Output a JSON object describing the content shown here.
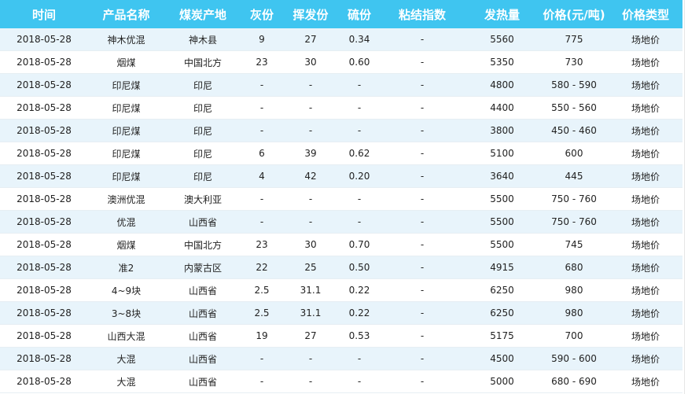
{
  "table": {
    "headers": [
      "时间",
      "产品名称",
      "煤炭产地",
      "灰份",
      "挥发份",
      "硫份",
      "粘结指数",
      "发热量",
      "价格(元/吨)",
      "价格类型"
    ],
    "rows": [
      [
        "2018-05-28",
        "神木优混",
        "神木县",
        "9",
        "27",
        "0.34",
        "-",
        "5560",
        "775",
        "场地价"
      ],
      [
        "2018-05-28",
        "烟煤",
        "中国北方",
        "23",
        "30",
        "0.60",
        "-",
        "5350",
        "730",
        "场地价"
      ],
      [
        "2018-05-28",
        "印尼煤",
        "印尼",
        "-",
        "-",
        "-",
        "-",
        "4800",
        "580 - 590",
        "场地价"
      ],
      [
        "2018-05-28",
        "印尼煤",
        "印尼",
        "-",
        "-",
        "-",
        "-",
        "4400",
        "550 - 560",
        "场地价"
      ],
      [
        "2018-05-28",
        "印尼煤",
        "印尼",
        "-",
        "-",
        "-",
        "-",
        "3800",
        "450 - 460",
        "场地价"
      ],
      [
        "2018-05-28",
        "印尼煤",
        "印尼",
        "6",
        "39",
        "0.62",
        "-",
        "5100",
        "600",
        "场地价"
      ],
      [
        "2018-05-28",
        "印尼煤",
        "印尼",
        "4",
        "42",
        "0.20",
        "-",
        "3640",
        "445",
        "场地价"
      ],
      [
        "2018-05-28",
        "澳洲优混",
        "澳大利亚",
        "-",
        "-",
        "-",
        "-",
        "5500",
        "750 - 760",
        "场地价"
      ],
      [
        "2018-05-28",
        "优混",
        "山西省",
        "-",
        "-",
        "-",
        "-",
        "5500",
        "750 - 760",
        "场地价"
      ],
      [
        "2018-05-28",
        "烟煤",
        "中国北方",
        "23",
        "30",
        "0.70",
        "-",
        "5500",
        "745",
        "场地价"
      ],
      [
        "2018-05-28",
        "准2",
        "内蒙古区",
        "22",
        "25",
        "0.50",
        "-",
        "4915",
        "680",
        "场地价"
      ],
      [
        "2018-05-28",
        "4~9块",
        "山西省",
        "2.5",
        "31.1",
        "0.22",
        "-",
        "6250",
        "980",
        "场地价"
      ],
      [
        "2018-05-28",
        "3~8块",
        "山西省",
        "2.5",
        "31.1",
        "0.22",
        "-",
        "6250",
        "980",
        "场地价"
      ],
      [
        "2018-05-28",
        "山西大混",
        "山西省",
        "19",
        "27",
        "0.53",
        "-",
        "5175",
        "700",
        "场地价"
      ],
      [
        "2018-05-28",
        "大混",
        "山西省",
        "-",
        "-",
        "-",
        "-",
        "4500",
        "590 - 600",
        "场地价"
      ],
      [
        "2018-05-28",
        "大混",
        "山西省",
        "-",
        "-",
        "-",
        "-",
        "5000",
        "680 - 690",
        "场地价"
      ]
    ]
  },
  "colors": {
    "header_bg": "#3fc5f0",
    "header_text": "#ffffff",
    "row_stripe": "#e8f4fb",
    "row_plain": "#ffffff"
  }
}
